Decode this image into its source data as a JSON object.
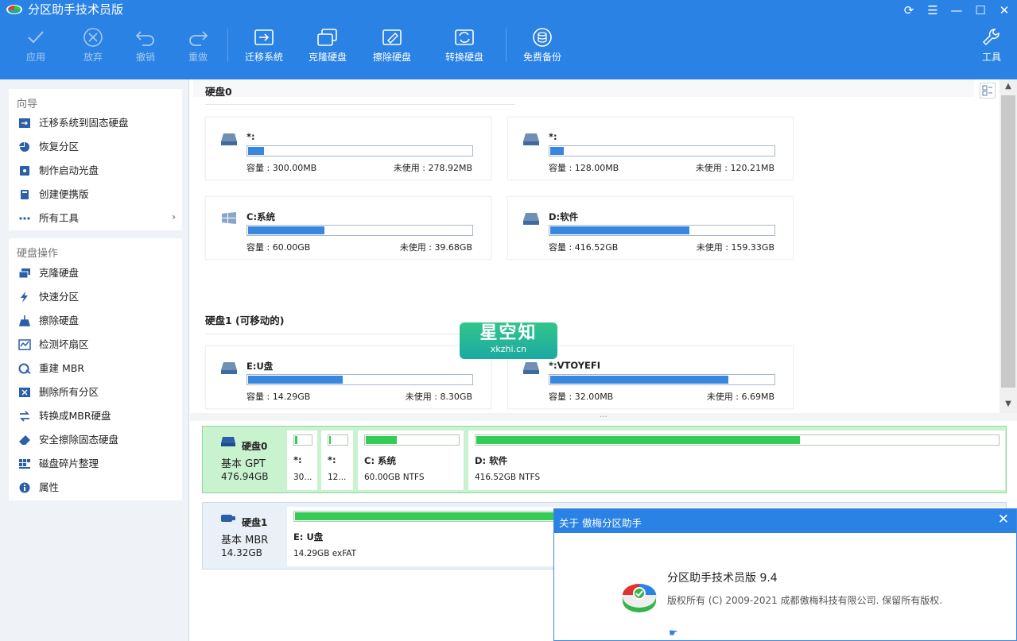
{
  "app": {
    "title": "分区助手技术员版"
  },
  "window_icons": [
    "refresh-icon",
    "menu-icon",
    "minimize-icon",
    "maximize-icon",
    "close-icon"
  ],
  "toolbar": {
    "apply": "应用",
    "discard": "放弃",
    "undo": "撤销",
    "redo": "重做",
    "migrate": "迁移系统",
    "clone": "克隆硬盘",
    "wipe": "擦除硬盘",
    "convert": "转换硬盘",
    "backup": "免费备份",
    "tools": "工具"
  },
  "sidebar": {
    "wizard_title": "向导",
    "wizard_items": [
      "迁移系统到固态硬盘",
      "恢复分区",
      "制作启动光盘",
      "创建便携版",
      "所有工具"
    ],
    "disk_ops_title": "硬盘操作",
    "disk_ops_items": [
      "克隆硬盘",
      "快速分区",
      "擦除硬盘",
      "检测坏扇区",
      "重建 MBR",
      "删除所有分区",
      "转换成MBR硬盘",
      "安全擦除固态硬盘",
      "磁盘碎片整理",
      "属性"
    ]
  },
  "disk_view": {
    "disk0_header": "硬盘0",
    "disk1_header": "硬盘1 (可移动的)",
    "cap_label": "容量 : ",
    "unused_label": "未使用 : ",
    "cards": [
      {
        "name": "*:",
        "capacity": "300.00MB",
        "unused": "278.92MB",
        "used_fraction": 0.07
      },
      {
        "name": "*:",
        "capacity": "128.00MB",
        "unused": "120.21MB",
        "used_fraction": 0.06
      },
      {
        "name": "C:系统",
        "capacity": "60.00GB",
        "unused": "39.68GB",
        "used_fraction": 0.34
      },
      {
        "name": "D:软件",
        "capacity": "416.52GB",
        "unused": "159.33GB",
        "used_fraction": 0.62
      },
      {
        "name": "E:U盘",
        "capacity": "14.29GB",
        "unused": "8.30GB",
        "used_fraction": 0.42
      },
      {
        "name": "*:VTOYEFI",
        "capacity": "32.00MB",
        "unused": "6.69MB",
        "used_fraction": 0.79
      }
    ]
  },
  "watermark": {
    "text": "星空知",
    "sub": "xkzhi.cn"
  },
  "disk_map": {
    "disk0": {
      "name": "硬盘0",
      "type": "基本 GPT",
      "size": "476.94GB",
      "partitions": [
        {
          "name": "*:",
          "detail": "30...",
          "used_fraction": 0.15
        },
        {
          "name": "*:",
          "detail": "12...",
          "used_fraction": 0.1
        },
        {
          "name": "C: 系统",
          "detail": "60.00GB NTFS",
          "used_fraction": 0.34
        },
        {
          "name": "D: 软件",
          "detail": "416.52GB NTFS",
          "used_fraction": 0.62
        }
      ]
    },
    "disk1": {
      "name": "硬盘1",
      "type": "基本 MBR",
      "size": "14.32GB",
      "partitions": [
        {
          "name": "E: U盘",
          "detail": "14.29GB exFAT",
          "used_fraction": 0.42
        }
      ]
    }
  },
  "about": {
    "title": "关于 傲梅分区助手",
    "product": "分区助手技术员版 9.4",
    "copyright": "版权所有 (C) 2009-2021 成都傲梅科技有限公司. 保留所有版权."
  },
  "colors": {
    "brand_blue": "#2a82e4",
    "used_bar": "#3a87e0",
    "partition_green": "#33cc55",
    "selected_row": "#c9f2cf"
  }
}
